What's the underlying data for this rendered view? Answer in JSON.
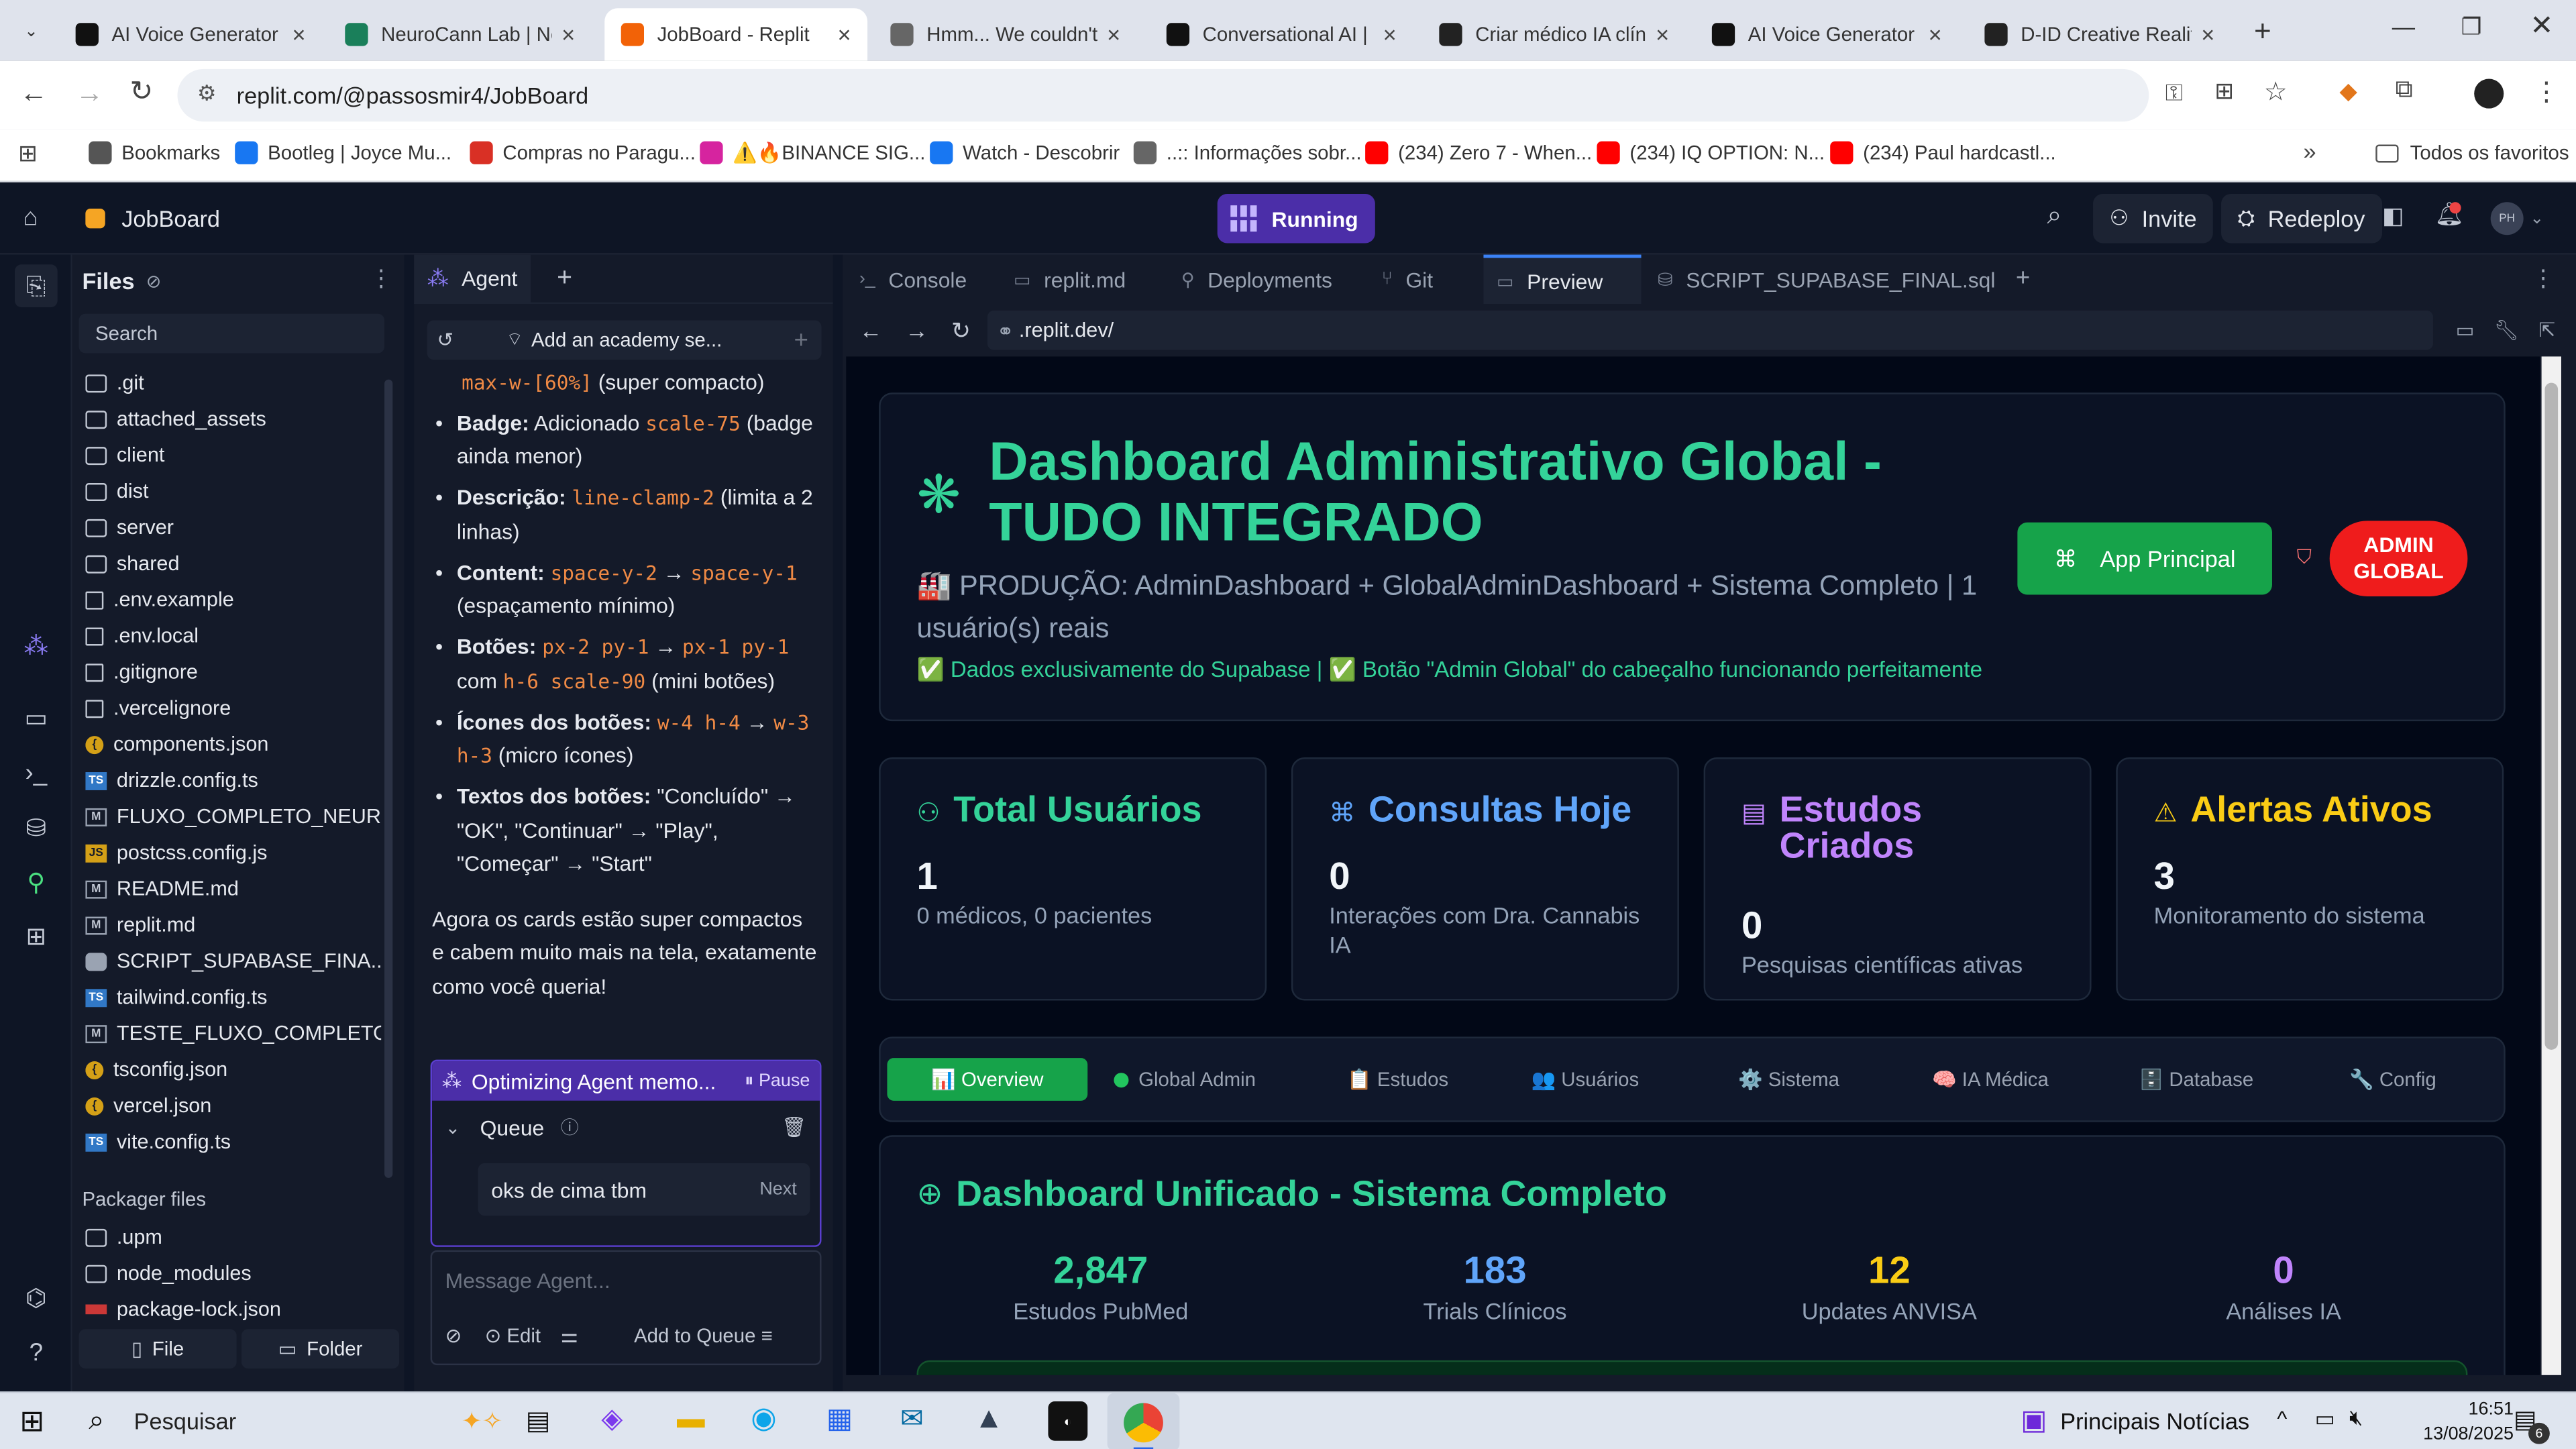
{
  "browser": {
    "tabs": [
      {
        "title": "AI Voice Generator &",
        "icon": "elevenlabs-icon",
        "color": "#111111",
        "active": false
      },
      {
        "title": "NeuroCann Lab | Ne",
        "icon": "neurocann-icon",
        "color": "#1a7f5a",
        "active": false
      },
      {
        "title": "JobBoard - Replit",
        "icon": "replit-icon",
        "color": "#f26207",
        "active": true
      },
      {
        "title": "Hmm... We couldn't r",
        "icon": "globe-icon",
        "color": "#666666",
        "active": false
      },
      {
        "title": "Conversational AI | E",
        "icon": "elevenlabs-icon",
        "color": "#111111",
        "active": false
      },
      {
        "title": "Criar médico IA clínic",
        "icon": "openai-icon",
        "color": "#222222",
        "active": false
      },
      {
        "title": "AI Voice Generator &",
        "icon": "elevenlabs-icon",
        "color": "#111111",
        "active": false
      },
      {
        "title": "D-ID Creative Reality",
        "icon": "did-icon",
        "color": "#222222",
        "active": false
      }
    ],
    "new_tab_label": "+",
    "url": "replit.com/@passosmir4/JobBoard",
    "bookmarks": [
      {
        "label": "Bookmarks",
        "icon": "star-icon",
        "color": "#555555"
      },
      {
        "label": "Bootleg | Joyce Mu...",
        "icon": "facebook-icon",
        "color": "#1877f2"
      },
      {
        "label": "Compras no Paragu...",
        "icon": "pin-icon",
        "color": "#d93025"
      },
      {
        "label": "⚠️🔥BINANCE SIG...",
        "icon": "instagram-icon",
        "color": "#d6249f"
      },
      {
        "label": "Watch - Descobrir",
        "icon": "facebook-icon",
        "color": "#1877f2"
      },
      {
        "label": "..:: Informações sobr...",
        "icon": "globe-icon",
        "color": "#666666"
      },
      {
        "label": "(234) Zero 7 - When...",
        "icon": "youtube-icon",
        "color": "#ff0000"
      },
      {
        "label": "(234) IQ OPTION: N...",
        "icon": "youtube-icon",
        "color": "#ff0000"
      },
      {
        "label": "(234) Paul hardcastl...",
        "icon": "youtube-icon",
        "color": "#ff0000"
      }
    ],
    "all_bookmarks": "Todos os favoritos"
  },
  "replit": {
    "project": "JobBoard",
    "run_status": "Running",
    "invite": "Invite",
    "redeploy": "Redeploy",
    "avatar": "PH",
    "files": {
      "title": "Files",
      "search_placeholder": "Search",
      "items": [
        {
          "name": ".git",
          "type": "folder"
        },
        {
          "name": "attached_assets",
          "type": "folder"
        },
        {
          "name": "client",
          "type": "folder"
        },
        {
          "name": "dist",
          "type": "folder"
        },
        {
          "name": "server",
          "type": "folder"
        },
        {
          "name": "shared",
          "type": "folder"
        },
        {
          "name": ".env.example",
          "type": "file"
        },
        {
          "name": ".env.local",
          "type": "file"
        },
        {
          "name": ".gitignore",
          "type": "file"
        },
        {
          "name": ".vercelignore",
          "type": "file"
        },
        {
          "name": "components.json",
          "type": "json"
        },
        {
          "name": "drizzle.config.ts",
          "type": "ts"
        },
        {
          "name": "FLUXO_COMPLETO_NEUR...",
          "type": "md"
        },
        {
          "name": "postcss.config.js",
          "type": "js"
        },
        {
          "name": "README.md",
          "type": "md"
        },
        {
          "name": "replit.md",
          "type": "md"
        },
        {
          "name": "SCRIPT_SUPABASE_FINA...",
          "type": "db"
        },
        {
          "name": "tailwind.config.ts",
          "type": "ts"
        },
        {
          "name": "TESTE_FLUXO_COMPLETO...",
          "type": "md"
        },
        {
          "name": "tsconfig.json",
          "type": "json"
        },
        {
          "name": "vercel.json",
          "type": "json"
        },
        {
          "name": "vite.config.ts",
          "type": "ts"
        }
      ],
      "packager_title": "Packager files",
      "packager_items": [
        {
          "name": ".upm",
          "type": "folder"
        },
        {
          "name": "node_modules",
          "type": "folder"
        },
        {
          "name": "package-lock.json",
          "type": "npm"
        }
      ],
      "new_file": "File",
      "new_folder": "Folder"
    },
    "agent": {
      "tab": "Agent",
      "thread_title": "Add an academy se...",
      "top_code": "max-w-[60%]",
      "top_note": "(super compacto)",
      "bullets": [
        {
          "label": "Badge:",
          "text1": "Adicionado",
          "code1": "scale-75",
          "text2": "(badge ainda menor)"
        },
        {
          "label": "Descrição:",
          "code1": "line-clamp-2",
          "text2": "(limita a 2 linhas)"
        },
        {
          "label": "Content:",
          "code1": "space-y-2",
          "arrow": "→",
          "code2": "space-y-1",
          "text2": "(espaçamento mínimo)"
        },
        {
          "label": "Botões:",
          "code1": "px-2 py-1",
          "arrow": "→",
          "code2": "px-1 py-1",
          "text1": "com",
          "code3": "h-6 scale-90",
          "text2": "(mini botões)"
        },
        {
          "label": "Ícones dos botões:",
          "code1": "w-4 h-4",
          "arrow": "→",
          "code2": "w-3 h-3",
          "text2": "(micro ícones)"
        },
        {
          "label": "Textos dos botões:",
          "text2": "\"Concluído\" → \"OK\", \"Continuar\" → \"Play\", \"Começar\" → \"Start\""
        }
      ],
      "summary": "Agora os cards estão super compactos e cabem muito mais na tela, exatamente como você queria!",
      "status": "Optimizing Agent memo...",
      "pause": "Pause",
      "queue_label": "Queue",
      "queue_item": "oks de cima tbm",
      "queue_next": "Next",
      "input_placeholder": "Message Agent...",
      "edit": "Edit",
      "add_to_queue": "Add to Queue"
    },
    "tabs": [
      {
        "label": "Console",
        "icon": "console-icon"
      },
      {
        "label": "replit.md",
        "icon": "markdown-icon"
      },
      {
        "label": "Deployments",
        "icon": "deploy-icon"
      },
      {
        "label": "Git",
        "icon": "git-icon"
      },
      {
        "label": "Preview",
        "icon": "preview-icon",
        "active": true
      },
      {
        "label": "SCRIPT_SUPABASE_FINAL.sql",
        "icon": "database-icon"
      }
    ],
    "preview_url": ".replit.dev/"
  },
  "dashboard": {
    "title_line1": "Dashboard Administrativo Global -",
    "title_line2": "TUDO INTEGRADO",
    "subtitle": "🏭 PRODUÇÃO: AdminDashboard + GlobalAdminDashboard + Sistema Completo | 1 usuário(s) reais",
    "supabase_note": "✅ Dados exclusivamente do Supabase | ✅ Botão \"Admin Global\" do cabeçalho funcionando perfeitamente",
    "app_button": "App Principal",
    "admin_badge": "ADMIN GLOBAL",
    "stats": [
      {
        "title": "Total Usuários",
        "value": "1",
        "desc": "0 médicos, 0 pacientes",
        "color": "#34d399",
        "icon": "users-icon"
      },
      {
        "title": "Consultas Hoje",
        "value": "0",
        "desc": "Interações com Dra. Cannabis IA",
        "color": "#60a5fa",
        "icon": "brain-icon"
      },
      {
        "title": "Estudos Criados",
        "value": "0",
        "desc": "Pesquisas científicas ativas",
        "color": "#c084fc",
        "icon": "document-icon"
      },
      {
        "title": "Alertas Ativos",
        "value": "3",
        "desc": "Monitoramento do sistema",
        "color": "#facc15",
        "icon": "alert-icon"
      }
    ],
    "nav": [
      {
        "label": "📊 Overview",
        "active": true
      },
      {
        "label": "Global Admin"
      },
      {
        "label": "📋 Estudos"
      },
      {
        "label": "👥 Usuários"
      },
      {
        "label": "⚙️ Sistema"
      },
      {
        "label": "🧠 IA Médica"
      },
      {
        "label": "🗄️ Database"
      },
      {
        "label": "🔧 Config"
      }
    ],
    "unified_title": "Dashboard Unificado - Sistema Completo",
    "metrics": [
      {
        "value": "2,847",
        "label": "Estudos PubMed",
        "color": "#34d399"
      },
      {
        "value": "183",
        "label": "Trials Clínicos",
        "color": "#60a5fa"
      },
      {
        "value": "12",
        "label": "Updates ANVISA",
        "color": "#facc15"
      },
      {
        "value": "0",
        "label": "Análises IA",
        "color": "#c084fc"
      }
    ]
  },
  "taskbar": {
    "search_placeholder": "Pesquisar",
    "news": "Principais Notícias",
    "time": "16:51",
    "date": "13/08/2025",
    "notif_count": "6"
  }
}
